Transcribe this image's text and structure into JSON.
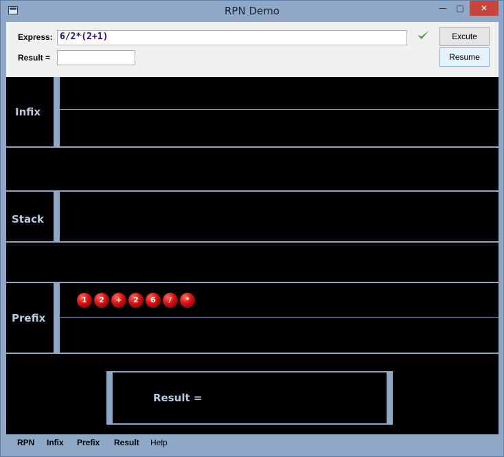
{
  "window": {
    "title": "RPN Demo"
  },
  "toolbar": {
    "express_label": "Express:",
    "express_value": "6/2*(2+1)",
    "result_label": "Result =",
    "result_value": "",
    "excute_label": "Excute",
    "resume_label": "Resume",
    "check_icon": "checkmark-icon",
    "check_color": "#3fa82c"
  },
  "sections": {
    "infix_label": "Infix",
    "stack_label": "Stack",
    "prefix_label": "Prefix"
  },
  "prefix_tokens": [
    "1",
    "2",
    "+",
    "2",
    "6",
    "/",
    "*"
  ],
  "result_panel": {
    "label": "Result ="
  },
  "menu": {
    "items": [
      "RPN",
      "Infix",
      "Prefix",
      "Result",
      "Help"
    ]
  },
  "colors": {
    "accent": "#8fa8c8",
    "canvas": "#000000",
    "token": "#d40f0f",
    "label": "#b8c9e0"
  }
}
